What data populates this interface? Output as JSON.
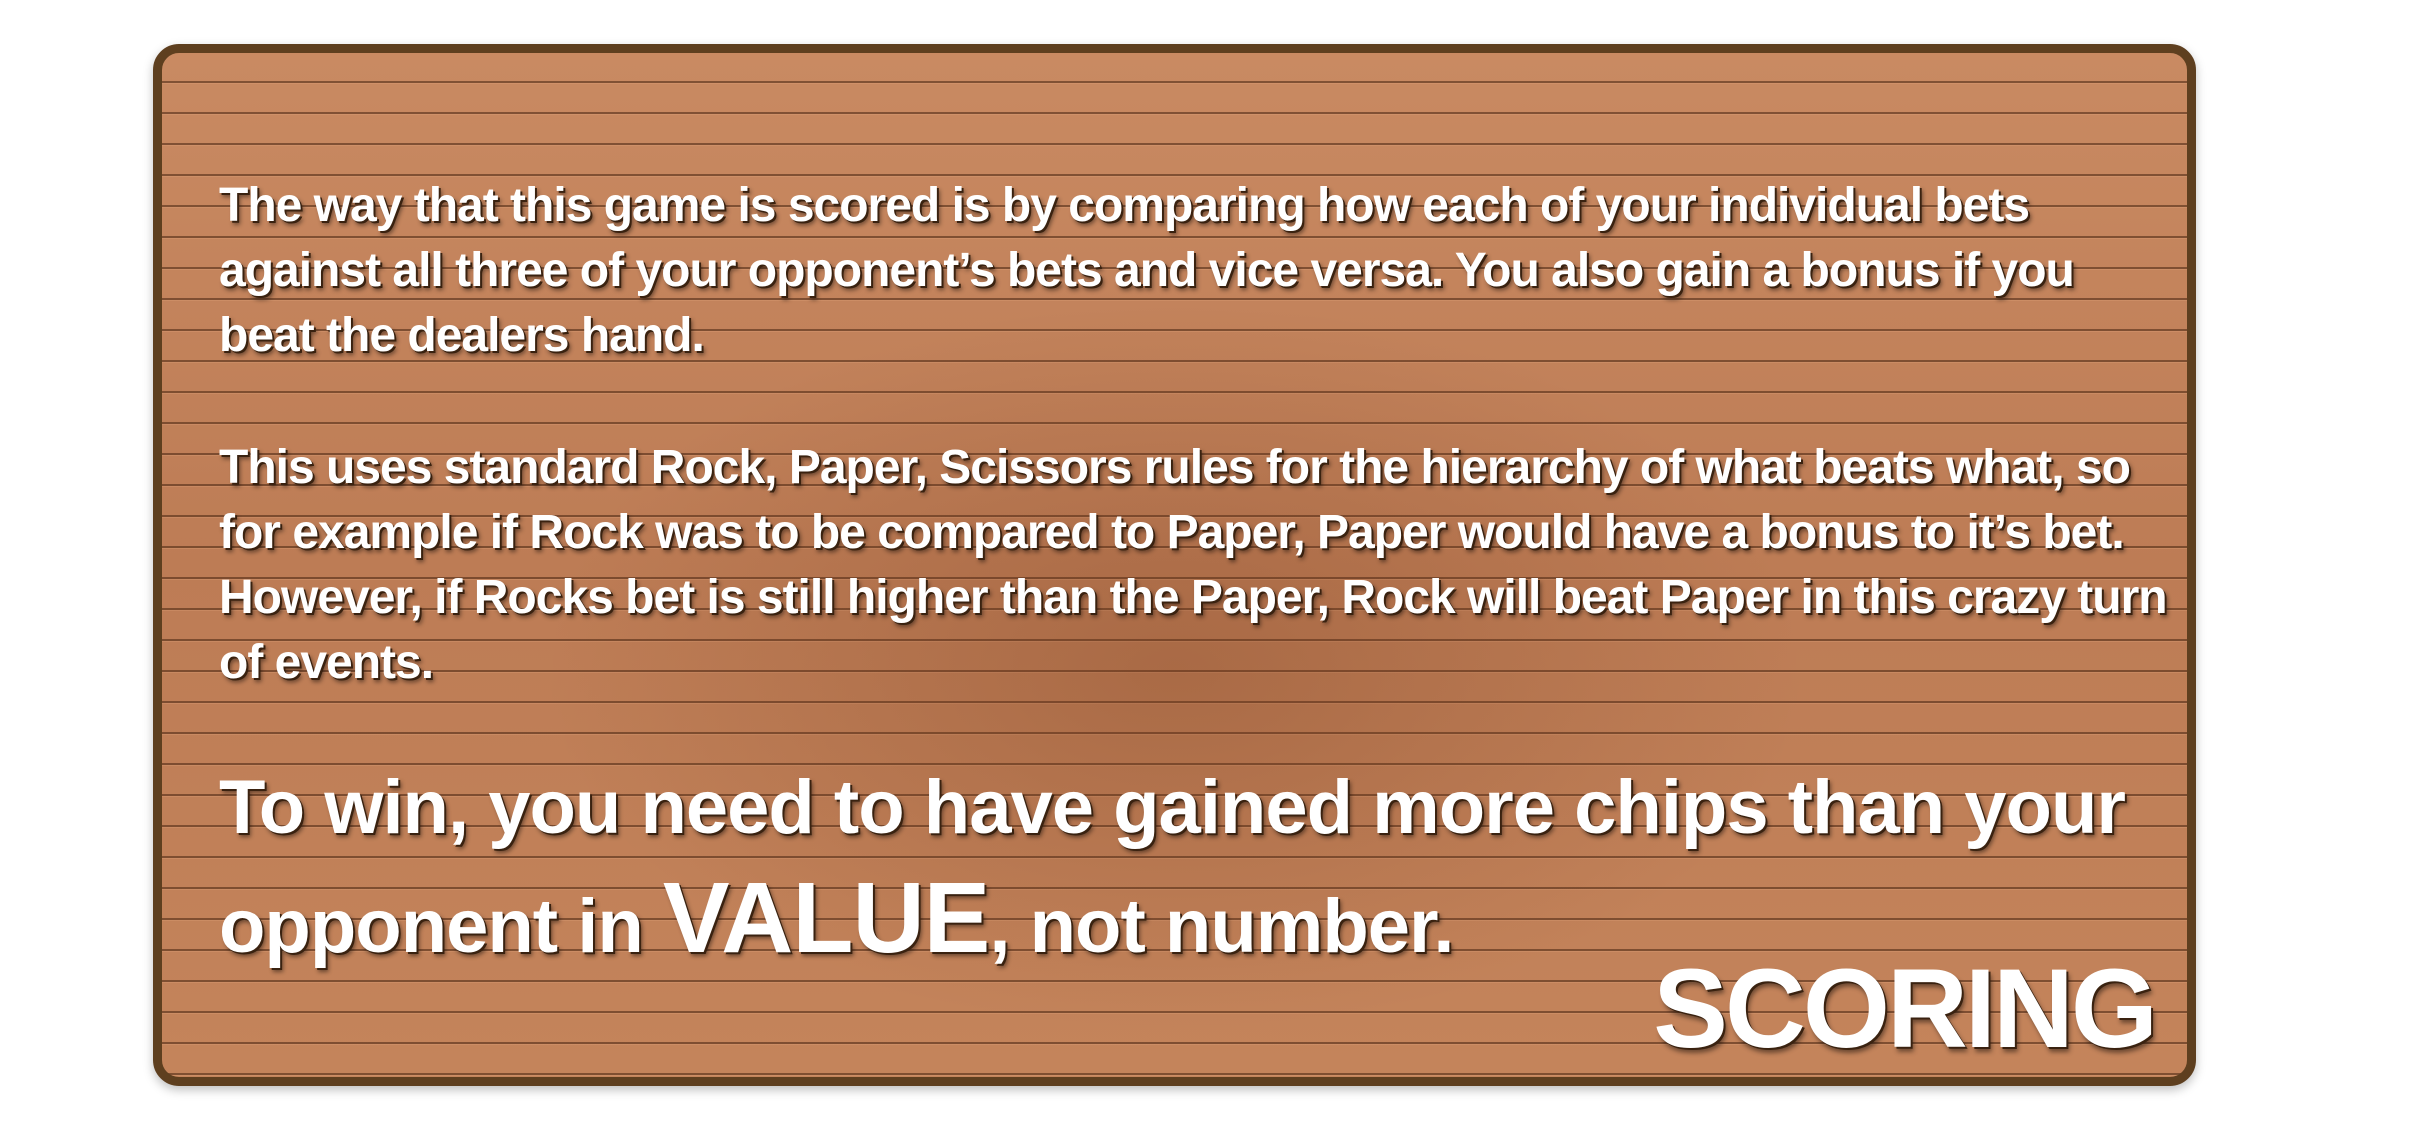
{
  "screen": {
    "title": "SCORING",
    "paragraphs": [
      "The way that this game is scored is by comparing how each of your individual bets against all three of your opponent’s bets and vice versa. You also gain a bonus if you beat the dealers hand.",
      "This uses standard Rock, Paper, Scissors rules for the hierarchy of what beats what, so for example if Rock was to be compared to Paper, Paper would have a bonus to it’s bet. However, if Rocks bet is still higher than the Paper, Rock will beat Paper in this crazy turn of events."
    ],
    "win_condition": {
      "prefix": "To win, you need to have gained more chips than your opponent in ",
      "emphasis": "VALUE",
      "suffix": ", not number."
    }
  },
  "colors": {
    "panel_wood": "#c98a62",
    "panel_border": "#5e3f1f",
    "text": "#ffffff"
  }
}
